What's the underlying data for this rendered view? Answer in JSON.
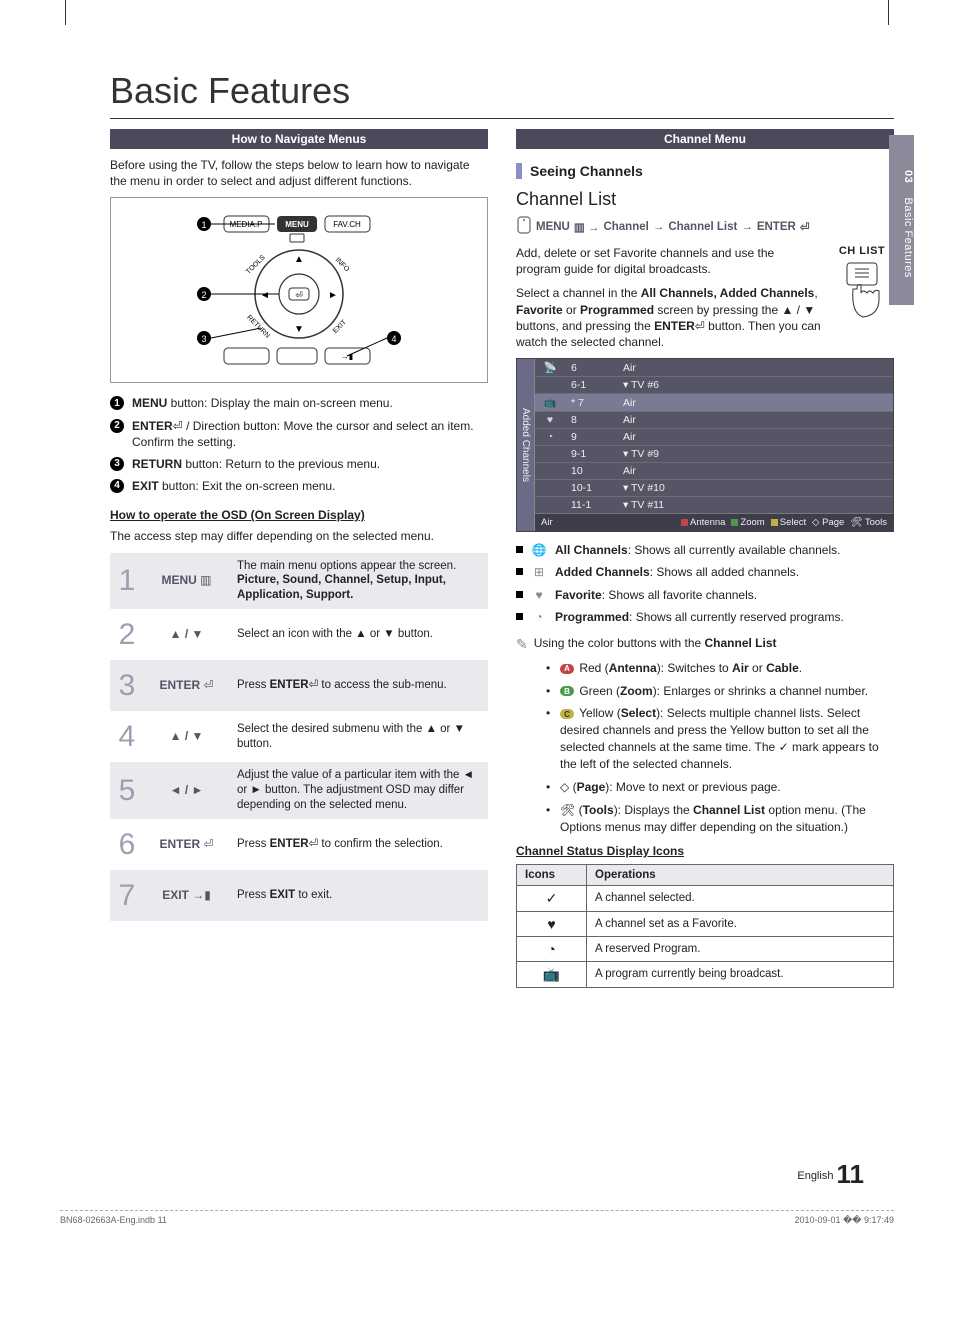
{
  "side_tab": {
    "num": "03",
    "label": "Basic Features"
  },
  "title": "Basic Features",
  "left": {
    "band": "How to Navigate Menus",
    "intro": "Before using the TV, follow the steps below to learn how to navigate the menu in order to select and adjust different functions.",
    "remote_labels": {
      "menu": "MENU",
      "media": "MEDIA.P",
      "fav": "FAV.CH",
      "tools": "TOOLS",
      "info": "INFO",
      "return": "RETURN",
      "exit": "EXIT"
    },
    "callouts": [
      {
        "n": "1",
        "bold": "MENU",
        "text": " button: Display the main on-screen menu."
      },
      {
        "n": "2",
        "bold": "ENTER",
        "glyph": "E",
        "text": " / Direction button: Move the cursor and select an item. Confirm the setting."
      },
      {
        "n": "3",
        "bold": "RETURN",
        "text": " button: Return to the previous menu."
      },
      {
        "n": "4",
        "bold": "EXIT",
        "text": " button: Exit the on-screen menu."
      }
    ],
    "osd_head": "How to operate the OSD (On Screen Display)",
    "osd_note": "The access step may differ depending on the selected menu.",
    "osd_steps": [
      {
        "n": "1",
        "key": "MENU",
        "keyglyph": "m",
        "desc": "The main menu options appear the screen.",
        "desc_bold": "Picture, Sound, Channel, Setup, Input, Application, Support."
      },
      {
        "n": "2",
        "key": "▲ / ▼",
        "desc": "Select an icon with the ▲ or ▼ button."
      },
      {
        "n": "3",
        "key": "ENTER",
        "keyglyph": "E",
        "desc": "Press ",
        "desc_mid_bold": "ENTER",
        "desc_mid_glyph": "E",
        "desc_after": " to access the sub-menu."
      },
      {
        "n": "4",
        "key": "▲ / ▼",
        "desc": "Select the desired submenu with the ▲ or ▼ button."
      },
      {
        "n": "5",
        "key": "◄ / ►",
        "desc": "Adjust the value of a particular item with the ◄ or ► button. The adjustment OSD may differ depending on the selected menu."
      },
      {
        "n": "6",
        "key": "ENTER",
        "keyglyph": "E",
        "desc": "Press ",
        "desc_mid_bold": "ENTER",
        "desc_mid_glyph": "E",
        "desc_after": " to confirm the selection."
      },
      {
        "n": "7",
        "key": "EXIT →",
        "keyglyph": "x",
        "desc": "Press ",
        "desc_mid_bold": "EXIT",
        "desc_after": " to exit."
      }
    ]
  },
  "right": {
    "band": "Channel Menu",
    "sec_head": "Seeing Channels",
    "chlist_title": "Channel List",
    "nav_path": {
      "a": "MENU",
      "b": "Channel",
      "c": "Channel List",
      "d": "ENTER"
    },
    "chlist_graphic_label": "CH LIST",
    "para1": "Add, delete or set Favorite channels and use the program guide for digital broadcasts.",
    "para2_pre": "Select a channel in the ",
    "para2_bold": "All Channels, Added Channels",
    "para2_mid": ", ",
    "para2_bold2": "Favorite",
    "para2_mid2": " or ",
    "para2_bold3": "Programmed",
    "para2_after": " screen by pressing the ▲ / ▼ buttons, and pressing the ",
    "para2_bold4": "ENTER",
    "para2_glyph": "E",
    "para2_end": " button. Then you can watch the selected channel.",
    "panel": {
      "tab": "Added Channels",
      "rows": [
        {
          "ico": "📡",
          "ch": "6",
          "name": "Air"
        },
        {
          "ico": "",
          "ch": "6-1",
          "name": "▾ TV #6"
        },
        {
          "ico": "📺",
          "ch": "* 7",
          "name": "Air",
          "sel": true
        },
        {
          "ico": "♥",
          "ch": "8",
          "name": "Air"
        },
        {
          "ico": "◔",
          "ch": "9",
          "name": "Air"
        },
        {
          "ico": "",
          "ch": "9-1",
          "name": "▾ TV #9"
        },
        {
          "ico": "",
          "ch": "10",
          "name": "Air"
        },
        {
          "ico": "",
          "ch": "10-1",
          "name": "▾ TV #10"
        },
        {
          "ico": "",
          "ch": "11-1",
          "name": "▾ TV #11"
        }
      ],
      "foot": {
        "left": "Air",
        "items": [
          "Antenna",
          "Zoom",
          "Select",
          "Page",
          "Tools"
        ]
      }
    },
    "ch_types": [
      {
        "ico": "🌐",
        "bold": "All Channels",
        "text": ": Shows all currently available channels."
      },
      {
        "ico": "⊞",
        "bold": "Added Channels",
        "text": ": Shows all added channels."
      },
      {
        "ico": "♥",
        "bold": "Favorite",
        "text": ": Shows all favorite channels."
      },
      {
        "ico": "◔",
        "bold": "Programmed",
        "text": ": Shows all currently reserved programs."
      }
    ],
    "color_note": "Using the color buttons with the ",
    "color_note_bold": "Channel List",
    "color_items": [
      {
        "pill": "red",
        "pillLetter": "A",
        "lead": "Red (",
        "bold": "Antenna",
        "after": "): Switches to ",
        "bold2": "Air",
        "after2": " or ",
        "bold3": "Cable",
        "after3": "."
      },
      {
        "pill": "green",
        "pillLetter": "B",
        "lead": "Green (",
        "bold": "Zoom",
        "after": "): Enlarges or shrinks a channel number."
      },
      {
        "pill": "yellow",
        "pillLetter": "C",
        "lead": "Yellow (",
        "bold": "Select",
        "after": "): Selects multiple channel lists. Select desired channels and press the Yellow button to set all the selected channels at the same time. The ✓ mark appears to the left of the selected channels."
      },
      {
        "glyph": "◇",
        "lead": "(",
        "bold": "Page",
        "after": "): Move to next or previous page."
      },
      {
        "glyph": "🛠",
        "lead": "(",
        "bold": "Tools",
        "after": "): Displays the ",
        "bold2": "Channel List",
        "after2": " option menu. (The Options menus may differ depending on the situation.)"
      }
    ],
    "status_head": "Channel Status Display Icons",
    "status_table": {
      "head": {
        "a": "Icons",
        "b": "Operations"
      },
      "rows": [
        {
          "ico": "✓",
          "text": "A channel selected."
        },
        {
          "ico": "♥",
          "text": "A channel set as a Favorite."
        },
        {
          "ico": "◔",
          "text": "A reserved Program."
        },
        {
          "ico": "📺",
          "text": "A program currently being broadcast."
        }
      ]
    }
  },
  "page_num": {
    "lang": "English",
    "num": "11"
  },
  "footer": {
    "left": "BN68-02663A-Eng.indb   11",
    "right": "2010-09-01   �� 9:17:49"
  }
}
